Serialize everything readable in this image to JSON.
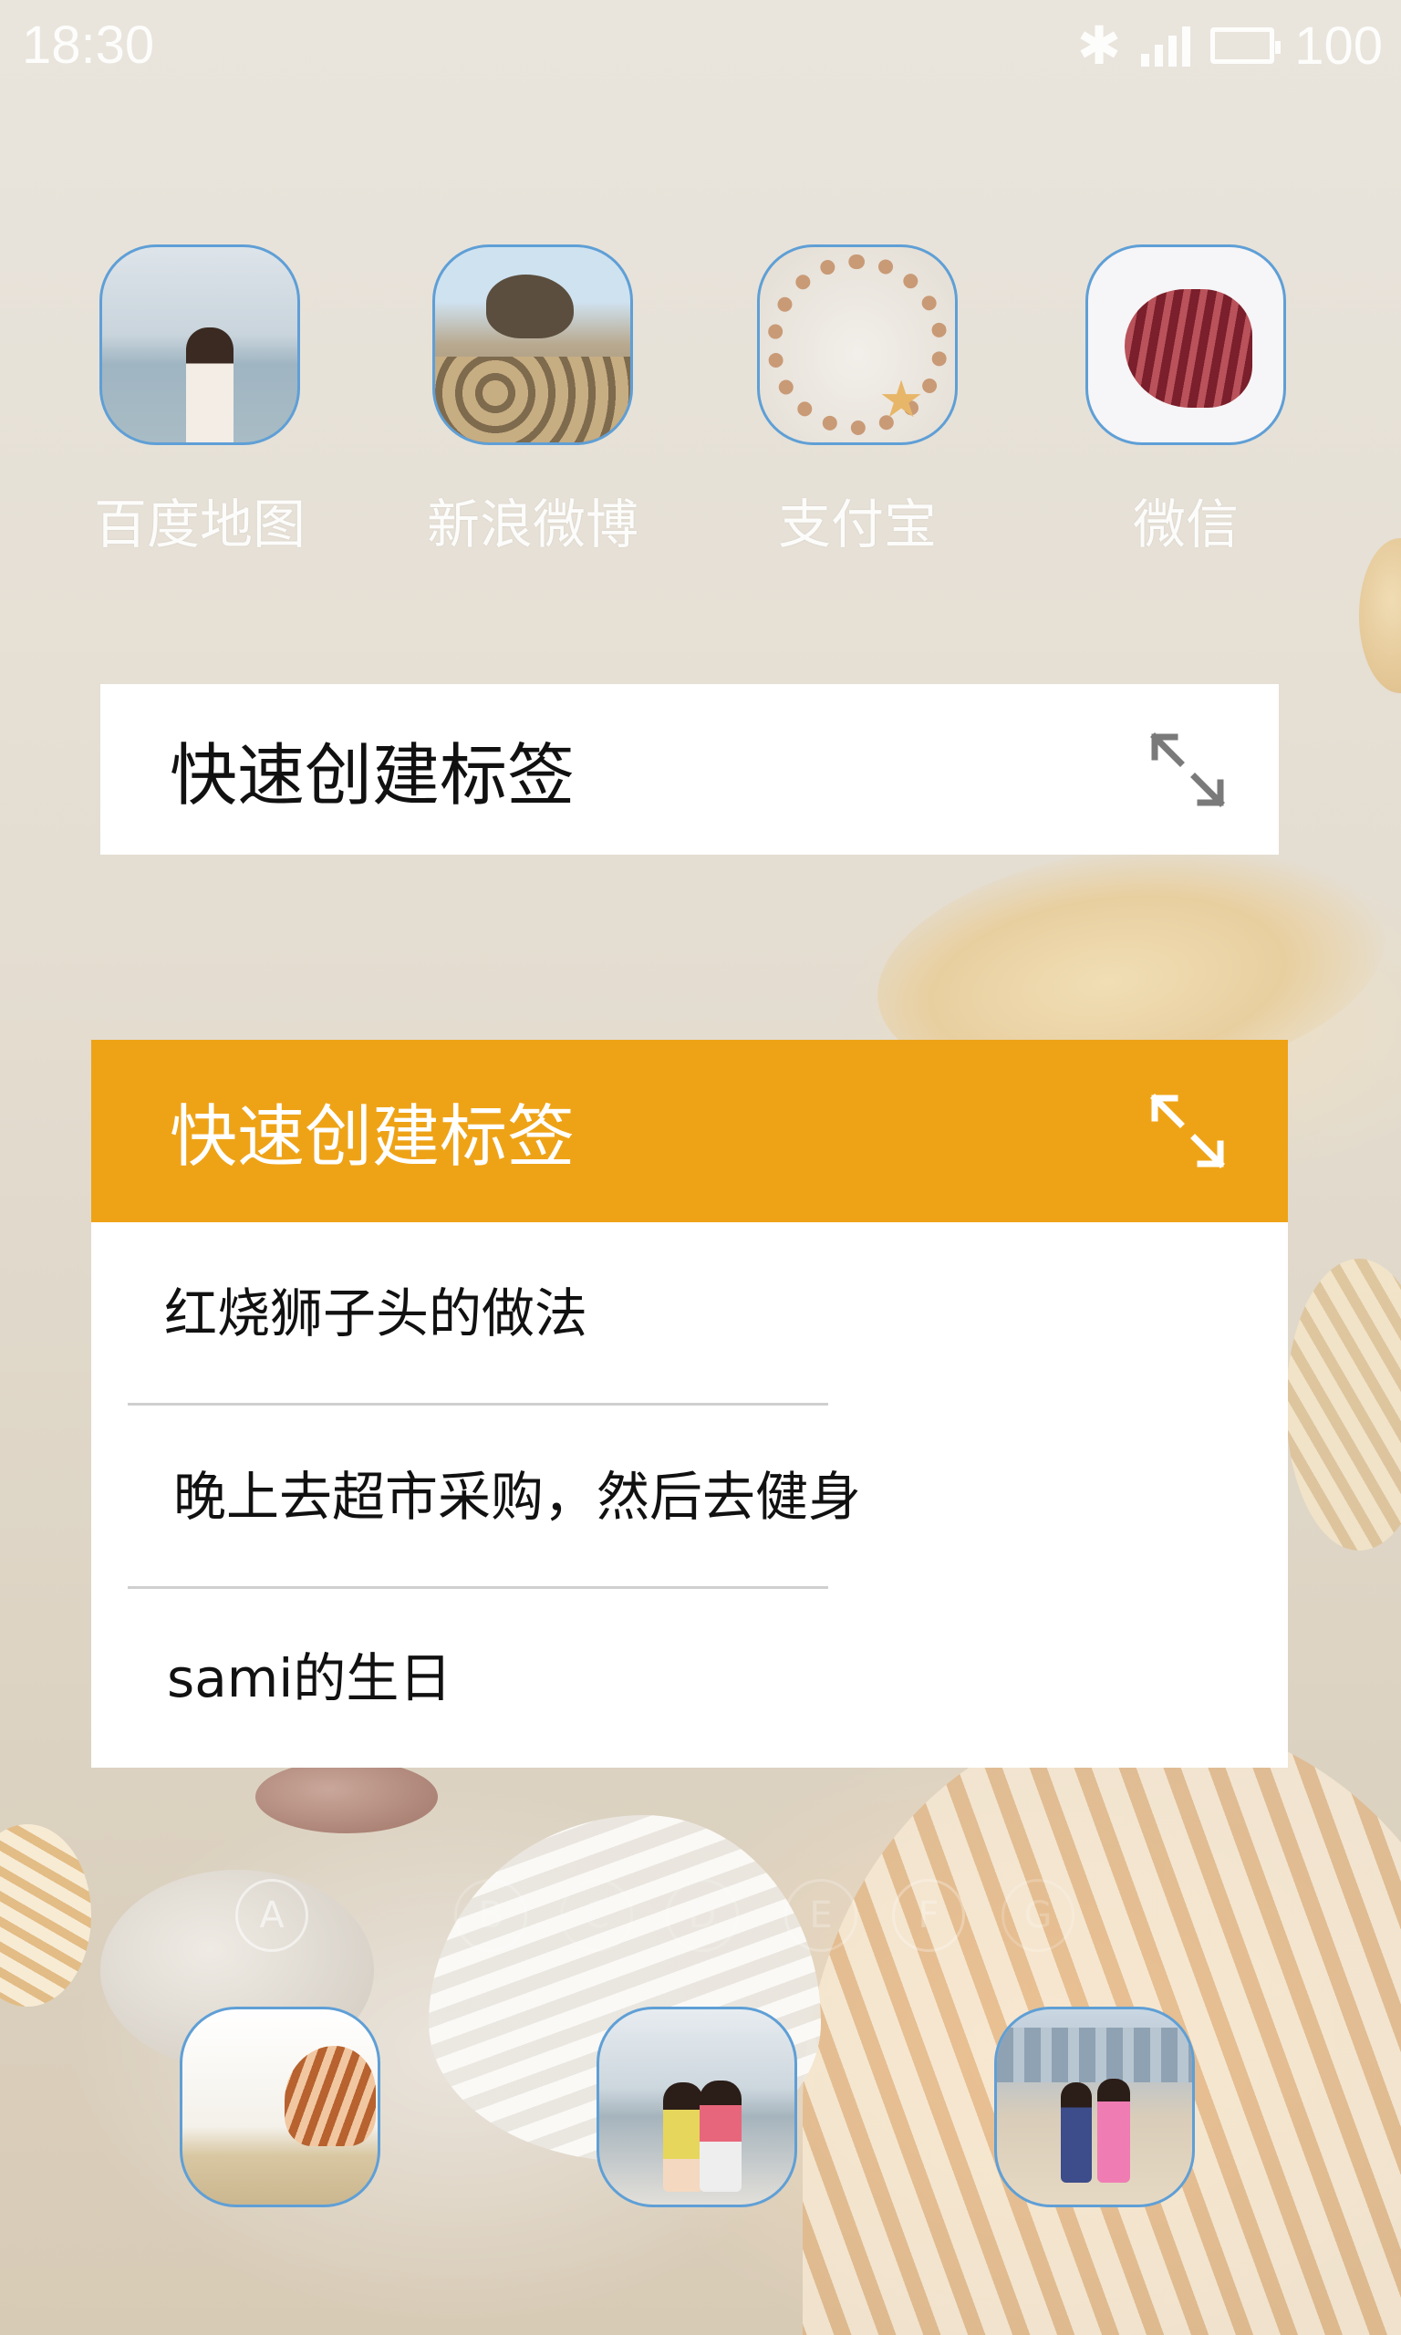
{
  "status_bar": {
    "time": "18:30",
    "battery": "100"
  },
  "apps": [
    {
      "label": "百度地图",
      "icon": "beach-woman-photo-icon"
    },
    {
      "label": "新浪微博",
      "icon": "rocky-shore-photo-icon"
    },
    {
      "label": "支付宝",
      "icon": "shell-ring-photo-icon"
    },
    {
      "label": "微信",
      "icon": "scallop-shell-photo-icon"
    }
  ],
  "widget_collapsed": {
    "title": "快速创建标签",
    "expand_icon": "expand-arrows-icon"
  },
  "widget_expanded": {
    "title": "快速创建标签",
    "expand_icon": "expand-arrows-icon",
    "accent_color": "#eea317",
    "notes": [
      "红烧狮子头的做法",
      "晚上去超市采购，然后去健身",
      "sami的生日"
    ]
  },
  "page_indicators": [
    "A",
    "B",
    "C",
    "D",
    "E",
    "F",
    "G"
  ],
  "dock": [
    {
      "icon": "shell-on-sand-photo-icon"
    },
    {
      "icon": "two-girls-beach-photo-icon"
    },
    {
      "icon": "beach-walkers-photo-icon"
    }
  ],
  "colors": {
    "icon_border": "#5f9fd6",
    "widget_header": "#eea317"
  }
}
